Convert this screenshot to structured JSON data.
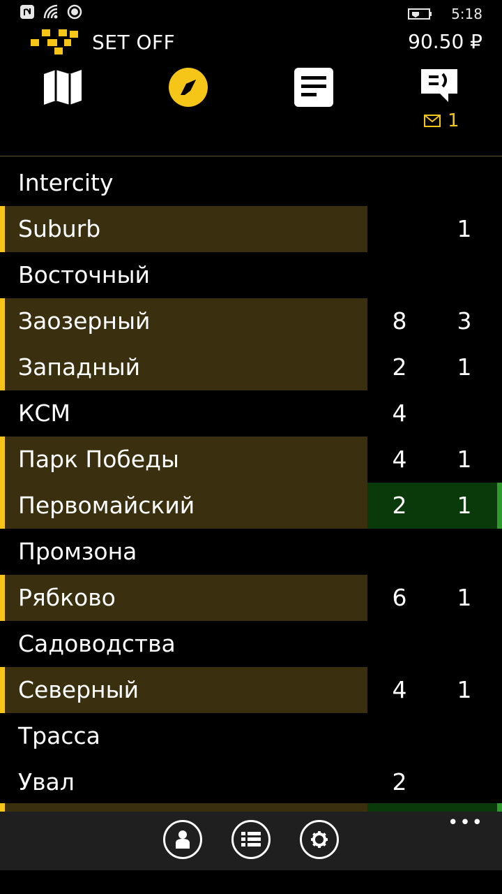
{
  "status_bar": {
    "time": "5:18",
    "left_icons": [
      "nfc-icon",
      "wifi-icon",
      "location-icon"
    ],
    "right_icons": [
      "battery-charging-icon"
    ]
  },
  "header": {
    "title": "SET OFF",
    "balance": "90.50 ₽"
  },
  "nav": {
    "items": [
      "map-icon",
      "compass-icon",
      "orders-icon",
      "chat-icon"
    ],
    "active": "compass-icon",
    "message_count": "1"
  },
  "colors": {
    "accent": "#f5c518",
    "row_highlight": "#3a3010",
    "green_highlight": "#0a3a0a",
    "green_bar": "#2e9a2e",
    "appbar": "#1f1f1f"
  },
  "zones": [
    {
      "name": "Intercity",
      "count1": "",
      "count2": "",
      "highlight": false,
      "green": false
    },
    {
      "name": "Suburb",
      "count1": "",
      "count2": "1",
      "highlight": true,
      "green": false
    },
    {
      "name": "Восточный",
      "count1": "",
      "count2": "",
      "highlight": false,
      "green": false
    },
    {
      "name": "Заозерный",
      "count1": "8",
      "count2": "3",
      "highlight": true,
      "green": false
    },
    {
      "name": "Западный",
      "count1": "2",
      "count2": "1",
      "highlight": true,
      "green": false
    },
    {
      "name": "КСМ",
      "count1": "4",
      "count2": "",
      "highlight": false,
      "green": false
    },
    {
      "name": "Парк Победы",
      "count1": "4",
      "count2": "1",
      "highlight": true,
      "green": false
    },
    {
      "name": "Первомайский",
      "count1": "2",
      "count2": "1",
      "highlight": true,
      "green": true
    },
    {
      "name": "Промзона",
      "count1": "",
      "count2": "",
      "highlight": false,
      "green": false
    },
    {
      "name": "Рябково",
      "count1": "6",
      "count2": "1",
      "highlight": true,
      "green": false
    },
    {
      "name": "Садоводства",
      "count1": "",
      "count2": "",
      "highlight": false,
      "green": false
    },
    {
      "name": "Северный",
      "count1": "4",
      "count2": "1",
      "highlight": true,
      "green": false
    },
    {
      "name": "Трасса",
      "count1": "",
      "count2": "",
      "highlight": false,
      "green": false
    },
    {
      "name": "Увал",
      "count1": "2",
      "count2": "",
      "highlight": false,
      "green": false
    }
  ],
  "app_bar": {
    "buttons": [
      "profile-icon",
      "list-icon",
      "settings-icon"
    ],
    "more": "•••"
  }
}
